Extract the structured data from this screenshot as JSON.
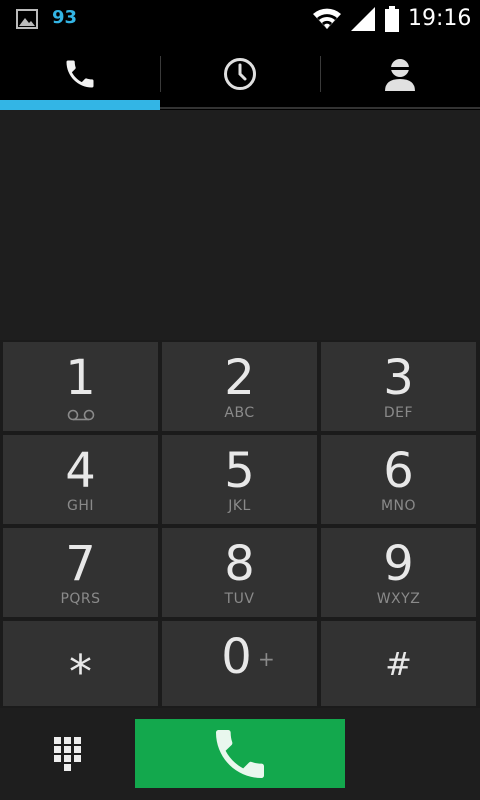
{
  "status_bar": {
    "notification_count": "93",
    "time": "19:16",
    "icons": [
      "gallery-icon",
      "wifi-icon",
      "signal-icon",
      "battery-icon"
    ]
  },
  "tabs": [
    {
      "name": "phone",
      "icon": "phone-icon",
      "selected": true
    },
    {
      "name": "recent",
      "icon": "clock-icon",
      "selected": false
    },
    {
      "name": "contacts",
      "icon": "person-icon",
      "selected": false
    }
  ],
  "display": {
    "number": ""
  },
  "keypad": {
    "keys": [
      {
        "digit": "1",
        "letters": ""
      },
      {
        "digit": "2",
        "letters": "ABC"
      },
      {
        "digit": "3",
        "letters": "DEF"
      },
      {
        "digit": "4",
        "letters": "GHI"
      },
      {
        "digit": "5",
        "letters": "JKL"
      },
      {
        "digit": "6",
        "letters": "MNO"
      },
      {
        "digit": "7",
        "letters": "PQRS"
      },
      {
        "digit": "8",
        "letters": "TUV"
      },
      {
        "digit": "9",
        "letters": "WXYZ"
      },
      {
        "digit": "*",
        "letters": ""
      },
      {
        "digit": "0",
        "letters": "+"
      },
      {
        "digit": "#",
        "letters": ""
      }
    ]
  },
  "colors": {
    "accent": "#33b5e5",
    "call_button": "#13a84d",
    "key_background": "#323232",
    "display_background": "#1e1e1e"
  }
}
